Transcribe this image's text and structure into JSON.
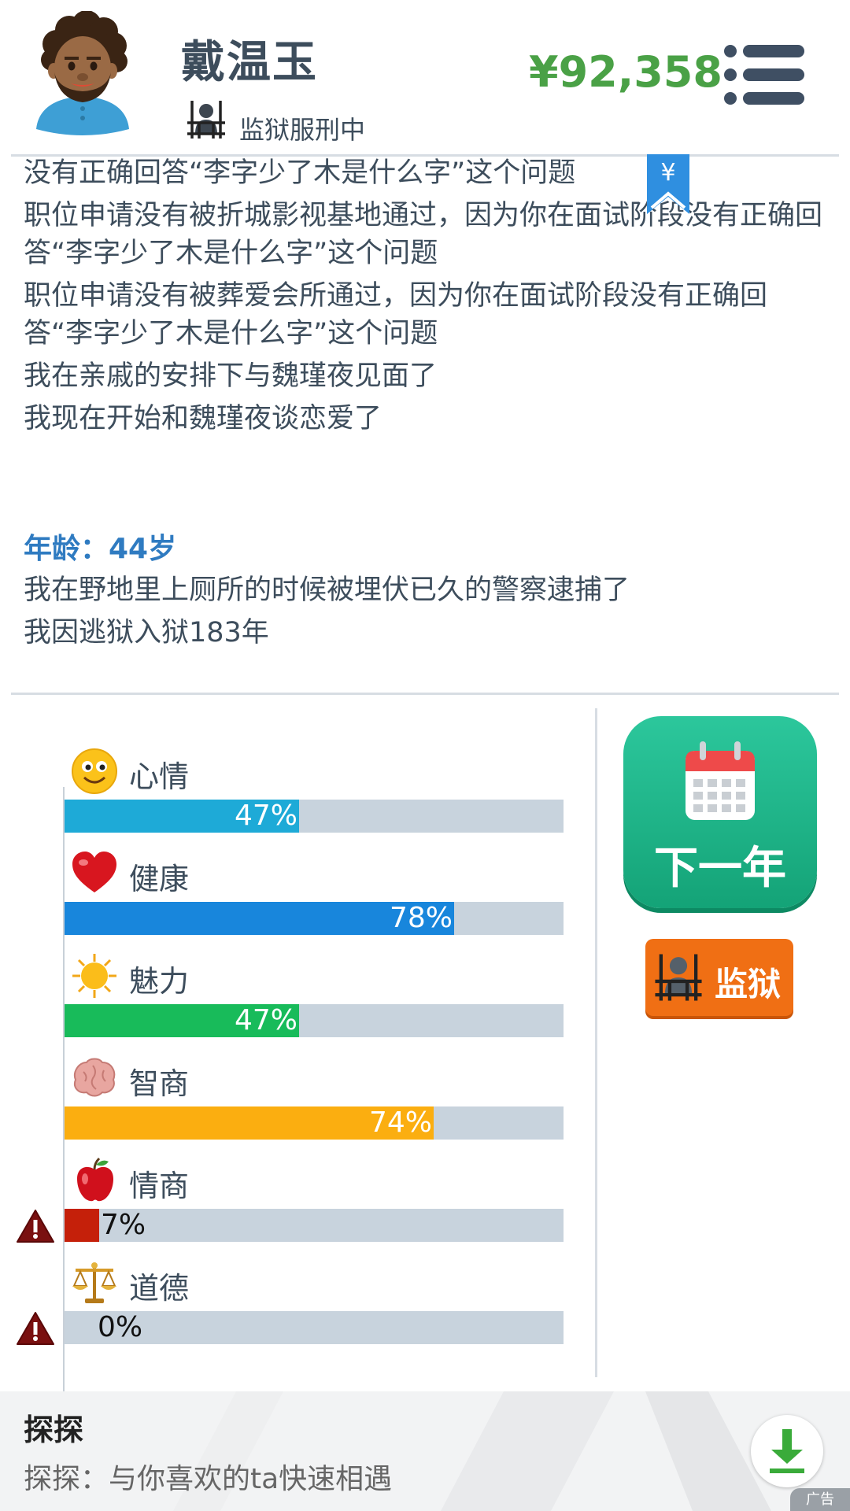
{
  "header": {
    "name": "戴温玉",
    "status": "监狱服刑中",
    "money": "¥92,358",
    "bookmark_symbol": "¥"
  },
  "log": {
    "lines_before": [
      "没有正确回答“李字少了木是什么字”这个问题",
      "职位申请没有被折城影视基地通过，因为你在面试阶段没有正确回答“李字少了木是什么字”这个问题",
      "职位申请没有被葬爱会所通过，因为你在面试阶段没有正确回答“李字少了木是什么字”这个问题",
      "我在亲戚的安排下与魏瑾夜见面了",
      "我现在开始和魏瑾夜谈恋爱了"
    ],
    "age_heading": "年龄：44岁",
    "lines_after": [
      "我在野地里上厕所的时候被埋伏已久的警察逮捕了",
      "我因逃狱入狱183年"
    ]
  },
  "stats": [
    {
      "label": "心情",
      "icon": "smiley-icon",
      "value": 47,
      "text": "47%",
      "color": "#1eaad7",
      "warning": false
    },
    {
      "label": "健康",
      "icon": "heart-icon",
      "value": 78,
      "text": "78%",
      "color": "#1886dc",
      "warning": false
    },
    {
      "label": "魅力",
      "icon": "sun-icon",
      "value": 47,
      "text": "47%",
      "color": "#18bb5a",
      "warning": false
    },
    {
      "label": "智商",
      "icon": "brain-icon",
      "value": 74,
      "text": "74%",
      "color": "#fbae10",
      "warning": false
    },
    {
      "label": "情商",
      "icon": "apple-icon",
      "value": 7,
      "text": "7%",
      "color": "#c5200a",
      "warning": true
    },
    {
      "label": "道德",
      "icon": "scales-icon",
      "value": 0,
      "text": "0%",
      "color": "#c5200a",
      "warning": true
    }
  ],
  "actions": {
    "next_year": "下一年",
    "prison": "监狱"
  },
  "ad": {
    "title": "探探",
    "description": "探探：与你喜欢的ta快速相遇",
    "badge": "广告"
  }
}
